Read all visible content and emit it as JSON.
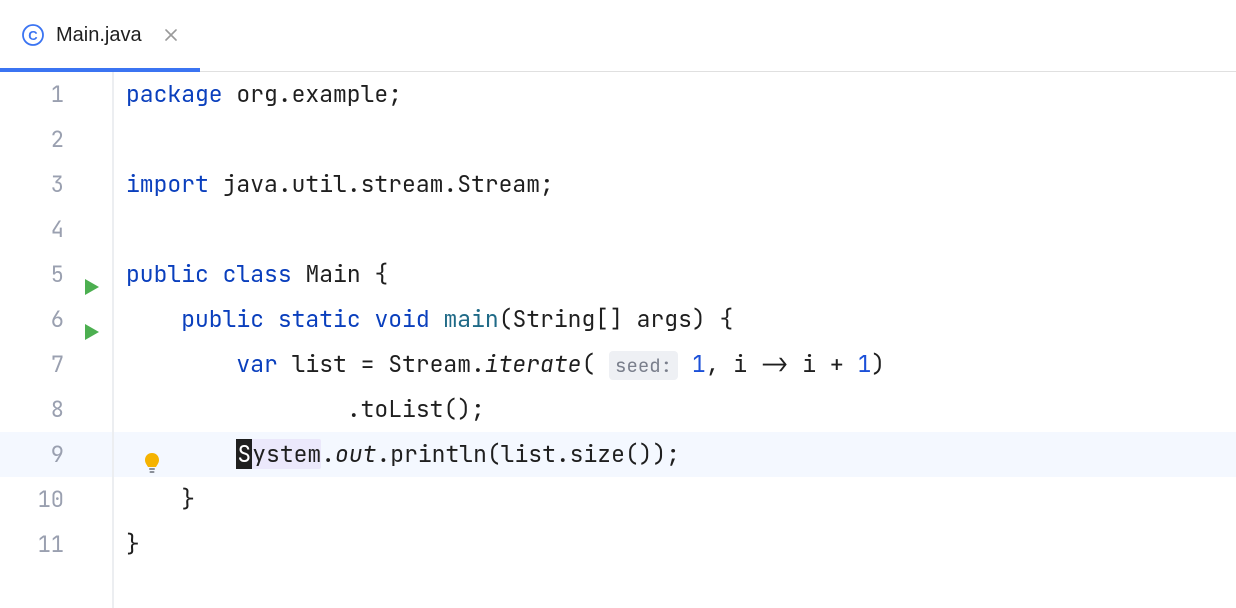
{
  "tab": {
    "filename": "Main.java",
    "active": true
  },
  "gutter": {
    "line_numbers": [
      "1",
      "2",
      "3",
      "4",
      "5",
      "6",
      "7",
      "8",
      "9",
      "10",
      "11"
    ],
    "run_markers_on_lines": [
      5,
      6
    ],
    "bulb_on_line": 9,
    "highlighted_line": 9
  },
  "code": {
    "l1": {
      "kw": "package",
      "rest": " org.example;"
    },
    "l2": "",
    "l3": {
      "kw": "import",
      "rest": " java.util.stream.Stream;"
    },
    "l4": "",
    "l5": {
      "kw1": "public",
      "kw2": "class",
      "name": " Main ",
      "brace": "{"
    },
    "l6": {
      "indent": "    ",
      "kw1": "public",
      "kw2": "static",
      "kw3": "void",
      "method": " main",
      "params": "(String[] args) {"
    },
    "l7": {
      "indent": "        ",
      "kw": "var",
      "text1": " list = Stream.",
      "iterate": "iterate",
      "open": "( ",
      "hint": "seed:",
      "num1": " 1",
      "text2": ", i -> i + ",
      "num2": "1",
      "close": ")"
    },
    "l8": {
      "indent": "                ",
      "text": ".toList();"
    },
    "l9": {
      "indent": "        ",
      "cursor_char": "S",
      "ident_rest": "ystem",
      "dot1": ".",
      "out": "out",
      "dot2": ".",
      "rest": "println(list.size());"
    },
    "l10": {
      "indent": "    ",
      "brace": "}"
    },
    "l11": {
      "brace": "}"
    }
  },
  "colors": {
    "accent": "#3b74f2",
    "keyword": "#0a3fbd",
    "number": "#1b50d8",
    "method_decl": "#1f6a87",
    "line_number": "#9aa0b0",
    "run_icon": "#4caf50",
    "bulb": "#f5b301"
  }
}
